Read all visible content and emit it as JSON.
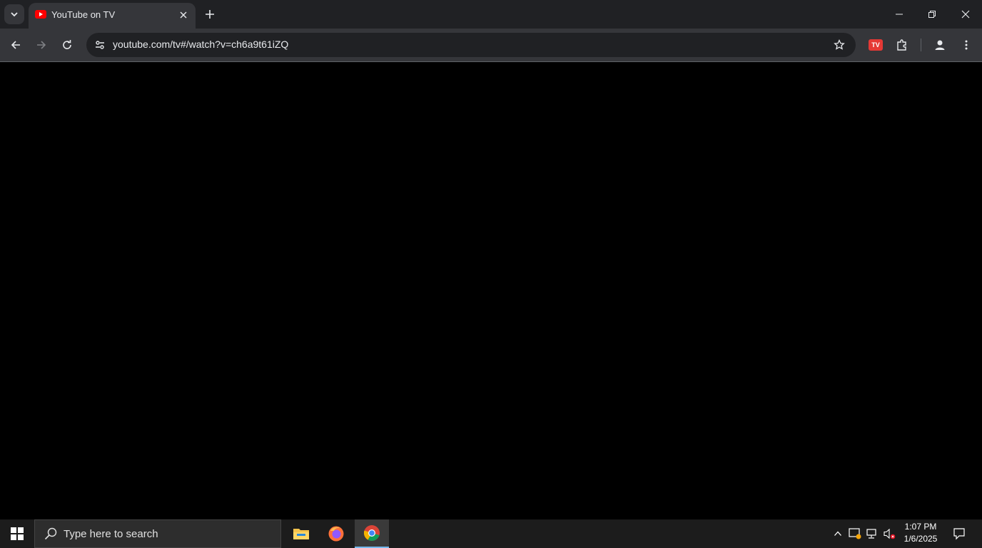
{
  "browser": {
    "tab": {
      "title": "YouTube on TV"
    },
    "address": {
      "url": "youtube.com/tv#/watch?v=ch6a9t61iZQ"
    },
    "extension": {
      "badge": "TV",
      "color": "#e53935"
    }
  },
  "taskbar": {
    "search_placeholder": "Type here to search",
    "apps": [
      "file-explorer",
      "firefox",
      "chrome"
    ],
    "clock": {
      "time": "1:07 PM",
      "date": "1/6/2025"
    }
  },
  "colors": {
    "tabstrip": "#202124",
    "toolbar": "#35363a",
    "accent": "#76b9ed"
  }
}
